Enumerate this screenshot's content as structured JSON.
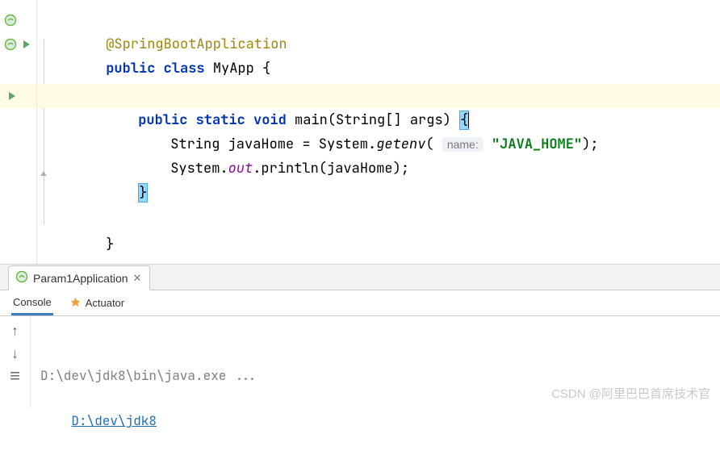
{
  "code": {
    "annotation": "@SpringBootApplication",
    "kw_public": "public",
    "kw_class": "class",
    "class_name": "MyApp",
    "brace_open": "{",
    "kw_static": "static",
    "kw_void": "void",
    "main_name": "main",
    "main_params": "(String[] args)",
    "main_brace_open": "{",
    "line_var": "String javaHome = System.",
    "getenv": "getenv",
    "paren_open": "(",
    "param_hint_label": "name:",
    "string_literal": "\"JAVA_HOME\"",
    "paren_close_semi": ");",
    "line_print_a": "System.",
    "out_field": "out",
    "line_print_b": ".println(javaHome);",
    "main_brace_close": "}",
    "class_brace_close": "}"
  },
  "run": {
    "tab_label": "Param1Application",
    "subtabs": {
      "console": "Console",
      "actuator": "Actuator"
    }
  },
  "console": {
    "line1": "D:\\dev\\jdk8\\bin\\java.exe ...",
    "line2": "D:\\dev\\jdk8"
  },
  "watermark": "CSDN @阿里巴巴首席技术官"
}
